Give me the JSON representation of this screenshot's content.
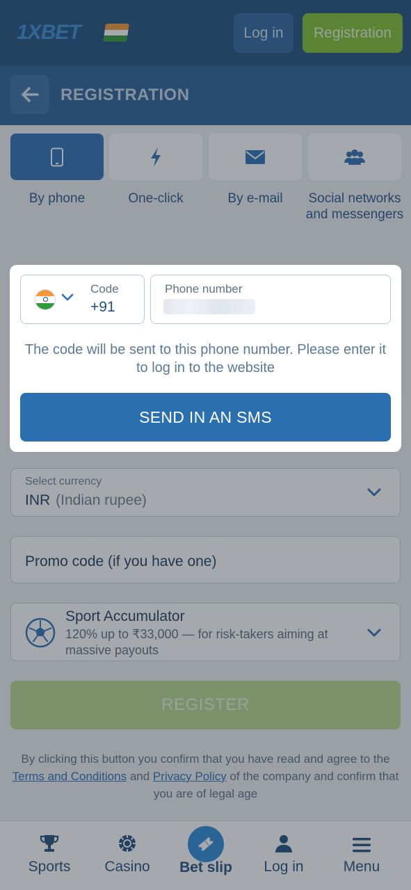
{
  "header": {
    "logo": "1XBET",
    "login_label": "Log in",
    "register_label": "Registration"
  },
  "titlebar": {
    "back_icon": "arrow-left-icon",
    "title": "REGISTRATION"
  },
  "tabs": [
    {
      "label": "By phone",
      "icon": "smartphone-icon",
      "active": true
    },
    {
      "label": "One-click",
      "icon": "lightning-icon",
      "active": false
    },
    {
      "label": "By e-mail",
      "icon": "envelope-icon",
      "active": false
    },
    {
      "label": "Social networks and messengers",
      "icon": "users-icon",
      "active": false
    }
  ],
  "phone_form": {
    "code_label": "Code",
    "code_value": "+91",
    "phone_label": "Phone number",
    "hint": "The code will be sent to this phone number. Please enter it to log in to the website",
    "send_button": "SEND IN AN SMS"
  },
  "currency": {
    "label": "Select currency",
    "code": "INR",
    "name": "(Indian rupee)"
  },
  "promo": {
    "placeholder": "Promo code (if you have one)"
  },
  "bonus": {
    "title": "Sport Accumulator",
    "description": "120% up to ₹33,000 — for risk-takers aiming at massive payouts"
  },
  "register_button": "REGISTER",
  "terms": {
    "part1": "By clicking this button you confirm that you have read and agree to the",
    "terms_link": "Terms and Conditions",
    "and": "and",
    "privacy_link": "Privacy Policy",
    "part2": "of the company and confirm that you are of legal age"
  },
  "bottom_nav": [
    {
      "label": "Sports",
      "icon": "trophy-icon"
    },
    {
      "label": "Casino",
      "icon": "casino-chip-icon"
    },
    {
      "label": "Bet slip",
      "icon": "ticket-icon"
    },
    {
      "label": "Log in",
      "icon": "user-icon"
    },
    {
      "label": "Menu",
      "icon": "hamburger-menu-icon"
    }
  ],
  "colors": {
    "header_bg": "#1f4f7d",
    "accent_blue": "#2a6fb0",
    "accent_green": "#7fbf2f"
  }
}
